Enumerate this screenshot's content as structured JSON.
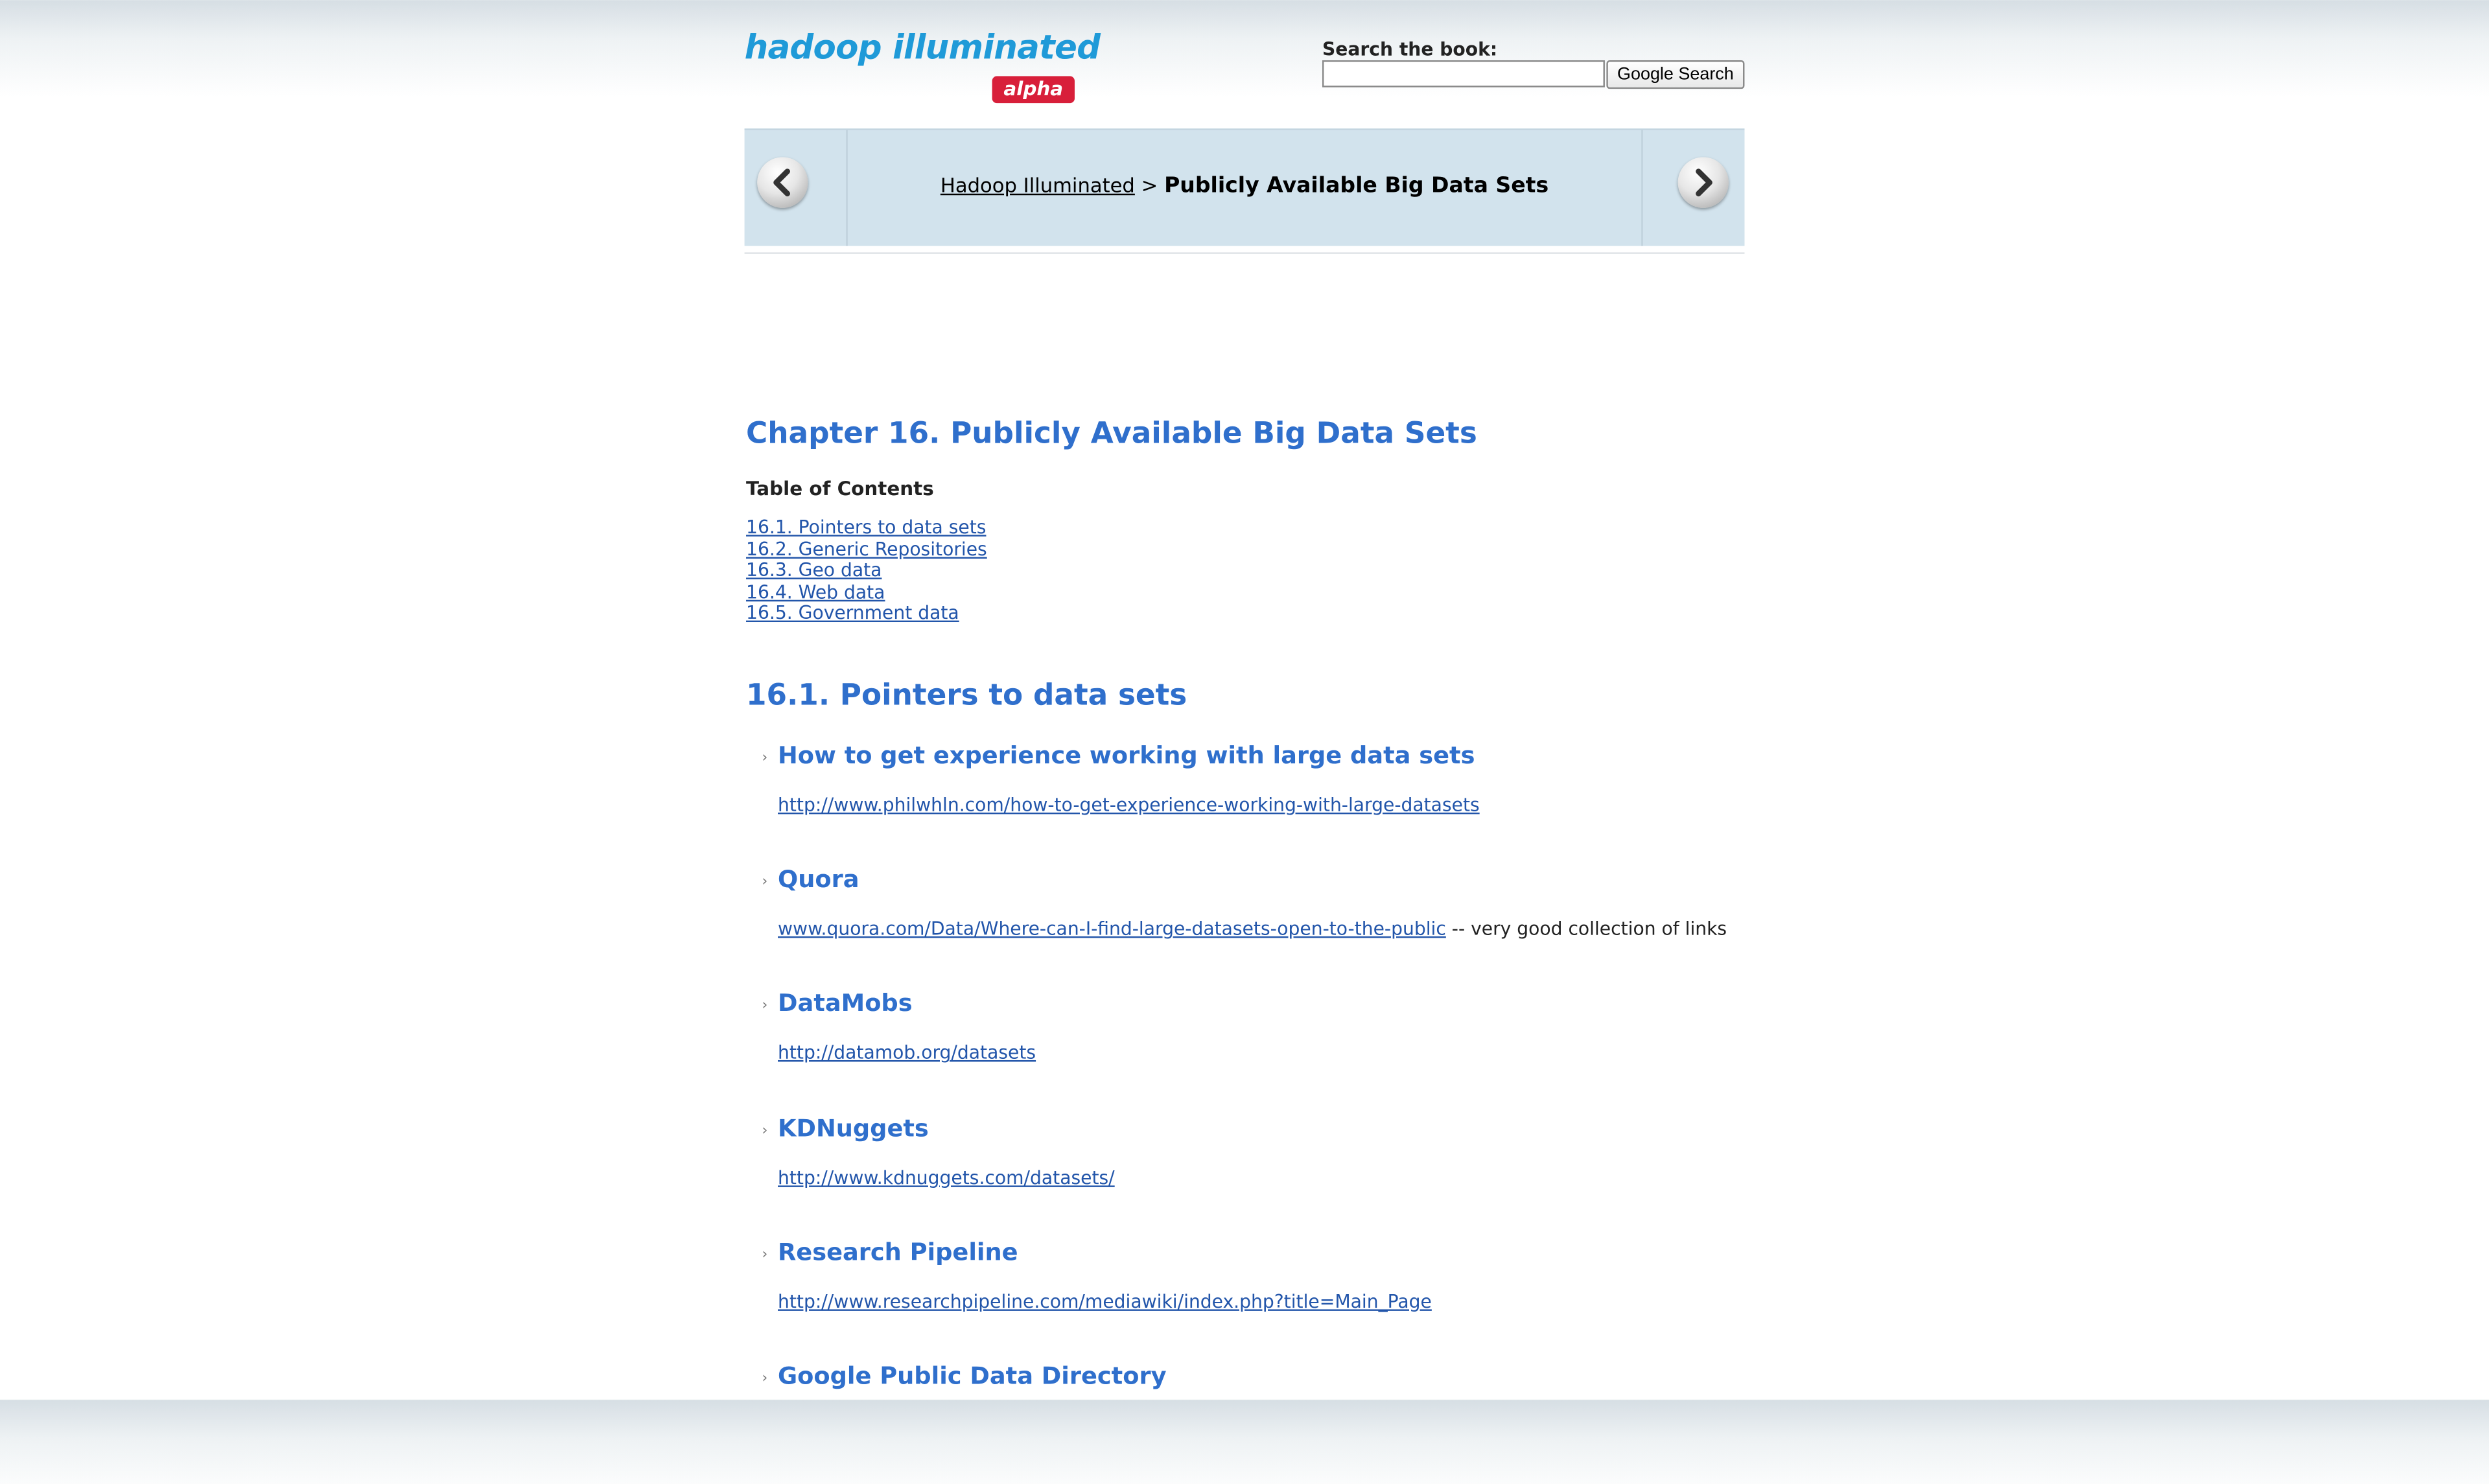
{
  "logo": {
    "text": "hadoop illuminated",
    "badge": "alpha"
  },
  "search": {
    "label": "Search the book:",
    "value": "",
    "button": "Google Search"
  },
  "breadcrumb": {
    "parent": "Hadoop Illuminated",
    "separator": ">",
    "current": "Publicly Available Big Data Sets"
  },
  "chapter": {
    "title": "Chapter 16. Publicly Available Big Data Sets",
    "toc_title": "Table of Contents",
    "toc": [
      "16.1. Pointers to data sets",
      "16.2. Generic Repositories",
      "16.3. Geo data",
      "16.4. Web data",
      "16.5. Government data"
    ]
  },
  "section": {
    "title": "16.1. Pointers to data sets",
    "bullet": "›",
    "entries": [
      {
        "title": "How to get experience working with large data sets",
        "link": "http://www.philwhln.com/how-to-get-experience-working-with-large-datasets",
        "note": ""
      },
      {
        "title": "Quora",
        "link": "www.quora.com/Data/Where-can-I-find-large-datasets-open-to-the-public",
        "note": " -- very good collection of links"
      },
      {
        "title": "DataMobs",
        "link": "http://datamob.org/datasets",
        "note": ""
      },
      {
        "title": "KDNuggets",
        "link": "http://www.kdnuggets.com/datasets/",
        "note": ""
      },
      {
        "title": "Research Pipeline",
        "link": "http://www.researchpipeline.com/mediawiki/index.php?title=Main_Page",
        "note": ""
      },
      {
        "title": "Google Public Data Directory",
        "link": "",
        "note": ""
      }
    ]
  },
  "colors": {
    "heading": "#2f6fcc",
    "link": "#2255aa",
    "navbar": "#d2e3ed",
    "logo": "#1f9ad8",
    "badge": "#d81f3a"
  },
  "icons": {
    "prev": "chevron-left-icon",
    "next": "chevron-right-icon"
  }
}
